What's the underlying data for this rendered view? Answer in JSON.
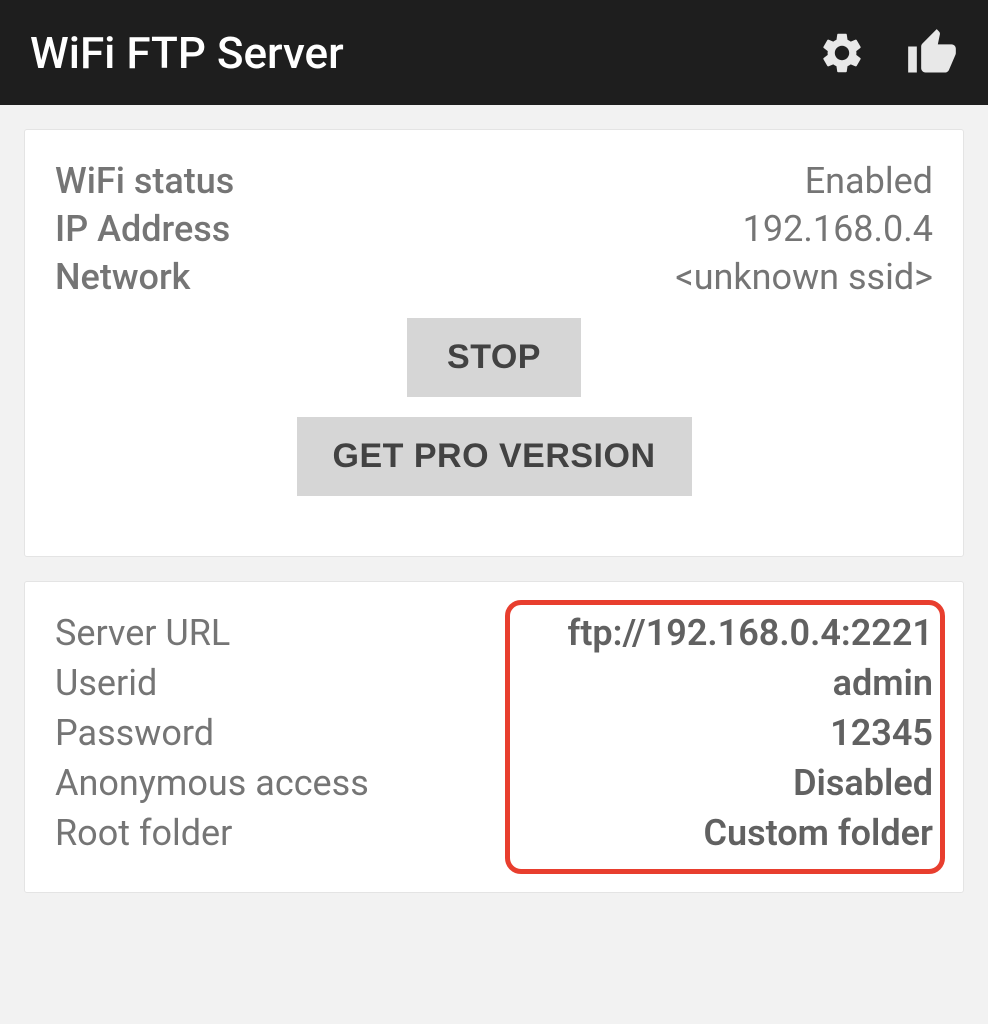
{
  "header": {
    "title": "WiFi FTP Server"
  },
  "status_card": {
    "rows": [
      {
        "label": "WiFi status",
        "value": "Enabled"
      },
      {
        "label": "IP Address",
        "value": "192.168.0.4"
      },
      {
        "label": "Network",
        "value": "<unknown ssid>"
      }
    ],
    "stop_button": "STOP",
    "pro_button": "GET PRO VERSION"
  },
  "server_card": {
    "rows": [
      {
        "label": "Server URL",
        "value": "ftp://192.168.0.4:2221"
      },
      {
        "label": "Userid",
        "value": "admin"
      },
      {
        "label": "Password",
        "value": "12345"
      },
      {
        "label": "Anonymous access",
        "value": "Disabled"
      },
      {
        "label": "Root folder",
        "value": "Custom folder"
      }
    ]
  }
}
